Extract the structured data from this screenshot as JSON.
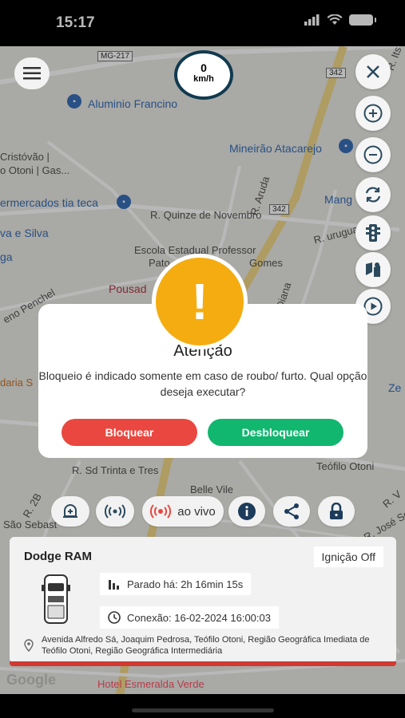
{
  "status_bar": {
    "time": "15:17"
  },
  "map": {
    "labels": {
      "mg217": "MG-217",
      "r342a": "342",
      "r342b": "342",
      "aluminio": "Aluminio Francino",
      "cristovao1": "Cristóvão |",
      "cristovao2": "o Otoni | Gas...",
      "mineirao": "Mineirão Atacarejo",
      "supermercados": "ermercados tia teca",
      "quinze": "R. Quinze de Novembro",
      "aruda": "R. Aruda",
      "uruguai": "R. uruguai",
      "mang": "Mang",
      "silva": "va e Silva",
      "ga": "ga",
      "escola": "Escola Estadual Professor",
      "pato": "Pato",
      "gomes": "Gomes",
      "pousada": "Pousad",
      "penchel": "eno Penchel",
      "diana": "Diana",
      "daria": "daria S",
      "ze": "Ze",
      "trinta": "R. Sd Trinta e Tres",
      "teofilo": "Teófilo Otoni",
      "belle": "Belle Vile",
      "rv": "R. V",
      "r2b": "R. 2B",
      "sebast": "São Sebast",
      "jose": "R. José Sor",
      "its": "R. Its",
      "hotel": "Hotel Esmeralda Verde"
    },
    "google_logo": "Google"
  },
  "speedometer": {
    "value": "0",
    "unit": "km/h"
  },
  "modal": {
    "title": "Atenção",
    "message": "Bloqueio é indicado somente em caso de roubo/ furto. Qual opção deseja executar?",
    "block_label": "Bloquear",
    "unblock_label": "Desbloquear",
    "icon": "exclamation-icon"
  },
  "actions": {
    "live_label": "ao vivo"
  },
  "vehicle": {
    "name": "Dodge RAM",
    "ignition": "Ignição Off",
    "stopped": "Parado há: 2h 16min 15s",
    "connection": "Conexão: 16-02-2024 16:00:03",
    "address": "Avenida Alfredo Sá, Joaquim Pedrosa, Teófilo Otoni, Região Geográfica Imediata de Teófilo Otoni, Região Geográfica Intermediária"
  },
  "colors": {
    "block": "#e9473f",
    "unblock": "#11b66f",
    "warning": "#f5ac10",
    "speed_ring": "#113a4f"
  }
}
